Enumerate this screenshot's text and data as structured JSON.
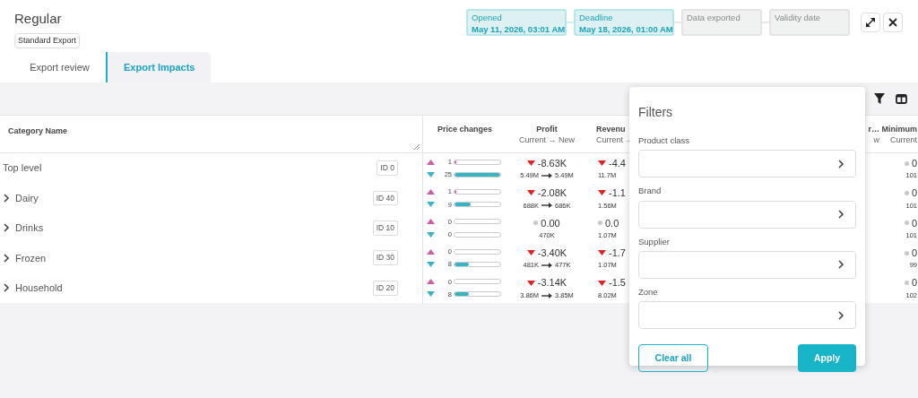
{
  "title": "Regular",
  "subtitle_tag": "Standard Export",
  "milestones": [
    {
      "label": "Opened",
      "value": "May 11, 2026, 03:01 AM",
      "done": true
    },
    {
      "label": "Deadline",
      "value": "May 18, 2026, 01:00 AM",
      "done": true
    },
    {
      "label": "Data exported",
      "done": false
    },
    {
      "label": "Validity date",
      "done": false
    }
  ],
  "tabs": [
    {
      "label": "Export review",
      "selected": false
    },
    {
      "label": "Export Impacts",
      "selected": true
    }
  ],
  "table": {
    "columns": {
      "category": "Category Name",
      "price": "Price changes",
      "profit": "Profit",
      "profit_sub": "Current → New",
      "revenue": "Revenu",
      "revenue_sub": "Current →",
      "hidden_tail": "r…",
      "hidden_tail_sub": "w",
      "minimum": "Minimum",
      "minimum_sub": "Current"
    },
    "rows": [
      {
        "name": "Top level",
        "expandable": false,
        "id": "ID 0",
        "up": "1",
        "up_level": {
          "level": 0.04
        },
        "down": "25",
        "down_level": {
          "level": 1
        },
        "profit": {
          "kind": "down",
          "delta": "-8.63K",
          "current": "5.49M",
          "new": "5.49M"
        },
        "revenue": {
          "kind": "down",
          "delta": "-4.4",
          "current": "11.7M"
        },
        "minimum": {
          "delta": "0",
          "current": "101"
        }
      },
      {
        "name": "Dairy",
        "expandable": true,
        "id": "ID 40",
        "up": "1",
        "up_level": {
          "level": 0.04
        },
        "down": "9",
        "down_level": {
          "level": 0.36
        },
        "profit": {
          "kind": "down",
          "delta": "-2.08K",
          "current": "688K",
          "new": "686K"
        },
        "revenue": {
          "kind": "down",
          "delta": "-1.1",
          "current": "1.56M"
        },
        "minimum": {
          "delta": "0",
          "current": "101"
        }
      },
      {
        "name": "Drinks",
        "expandable": true,
        "id": "ID 10",
        "up": "0",
        "up_level": {
          "level": 0
        },
        "down": "0",
        "down_level": {
          "level": 0
        },
        "profit": {
          "kind": "flat",
          "delta": "0.00",
          "current": "470K"
        },
        "revenue": {
          "kind": "flat",
          "delta": "0.0",
          "current": "1.07M"
        },
        "minimum": {
          "delta": "0",
          "current": "101"
        }
      },
      {
        "name": "Frozen",
        "expandable": true,
        "id": "ID 30",
        "up": "0",
        "up_level": {
          "level": 0
        },
        "down": "8",
        "down_level": {
          "level": 0.32
        },
        "profit": {
          "kind": "down",
          "delta": "-3.40K",
          "current": "481K",
          "new": "477K"
        },
        "revenue": {
          "kind": "down",
          "delta": "-1.7",
          "current": "1.07M"
        },
        "minimum": {
          "delta": "0",
          "current": "99"
        }
      },
      {
        "name": "Household",
        "expandable": true,
        "id": "ID 20",
        "up": "0",
        "up_level": {
          "level": 0
        },
        "down": "8",
        "down_level": {
          "level": 0.32
        },
        "profit": {
          "kind": "down",
          "delta": "-3.14K",
          "current": "3.86M",
          "new": "3.85M"
        },
        "revenue": {
          "kind": "down",
          "delta": "-1.5",
          "current": "8.02M"
        },
        "minimum": {
          "delta": "0",
          "current": "102"
        }
      }
    ]
  },
  "filters": {
    "title": "Filters",
    "fields": [
      {
        "label": "Product class"
      },
      {
        "label": "Brand"
      },
      {
        "label": "Supplier"
      },
      {
        "label": "Zone"
      }
    ],
    "clear": "Clear all",
    "apply": "Apply"
  }
}
